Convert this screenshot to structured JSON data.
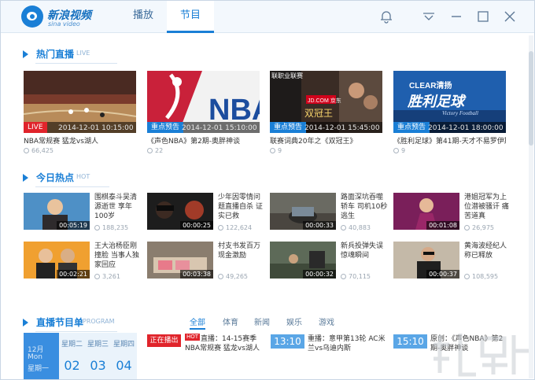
{
  "app": {
    "logo_cn": "新浪视频",
    "logo_en": "sina video",
    "tabs": [
      {
        "label": "播放"
      },
      {
        "label": "节目"
      }
    ],
    "active_tab": "节目",
    "accent": "#1a7fd6",
    "live_red": "#e0242b"
  },
  "hot_live": {
    "title": "热门直播",
    "title_en": "LIVE",
    "cards": [
      {
        "badge": "LIVE",
        "time": "2014-12-01 10:15:00",
        "title": "NBA常规赛 猛龙vs湖人",
        "meta": "66,425"
      },
      {
        "badge": "重点预告",
        "time": "2014-12-01 15:10:00",
        "title": "《声色NBA》第2期-奥胖神谈",
        "meta": "22"
      },
      {
        "badge": "重点预告",
        "time": "2014-12-01 15:45:00",
        "title": "联赛词典20年之《双冠王》",
        "meta": "9",
        "thumb_texts": [
          "联职业联赛",
          "JD.COM 京东",
          "双冠王"
        ]
      },
      {
        "badge": "重点预告",
        "time": "2014-12-01 18:00:00",
        "title": "《胜利足球》第41期-天才不易罗伊斯",
        "meta": "9",
        "thumb_texts": [
          "CLEAR清扬",
          "胜利足球",
          "Victory Football"
        ]
      }
    ]
  },
  "hot_today": {
    "title": "今日热点",
    "title_en": "HOT",
    "items": [
      {
        "duration": "00:05:19",
        "title": "围棋泰斗吴清源逝世 享年100岁",
        "count": "188,235"
      },
      {
        "duration": "00:00:25",
        "title": "少年因零情问题直播自杀 证实已救",
        "count": "122,624"
      },
      {
        "duration": "00:00:33",
        "title": "路面深坑吞噬轿车 司机10秒逃生",
        "count": "40,883"
      },
      {
        "duration": "00:01:08",
        "title": "港姐冠军为上位潜被骚讦 痛苦道真",
        "count": "26,975"
      },
      {
        "duration": "00:02:21",
        "title": "王大治杨臣刚撞脸 当事人独家回应",
        "count": "3,261"
      },
      {
        "duration": "00:03:38",
        "title": "村支书发百万现金激励",
        "count": "49,265"
      },
      {
        "duration": "00:00:32",
        "title": "新兵投弹失误惊魂瞬间",
        "count": "70,115"
      },
      {
        "duration": "00:00:37",
        "title": "黄海波经纪人称已释放",
        "count": "108,595"
      }
    ]
  },
  "program": {
    "title": "直播节目单",
    "title_en": "PROGRAM",
    "tabs": [
      {
        "label": "全部"
      },
      {
        "label": "体育"
      },
      {
        "label": "新闻"
      },
      {
        "label": "娱乐"
      },
      {
        "label": "游戏"
      }
    ],
    "calendar": {
      "month": "12月",
      "mon": "Mon",
      "today": "星期一",
      "days": [
        {
          "weekday": "星期二",
          "num": "02"
        },
        {
          "weekday": "星期三",
          "num": "03"
        },
        {
          "weekday": "星期四",
          "num": "04"
        }
      ]
    },
    "onair_label": "正在播出",
    "hot_tag": "HOT",
    "entries": [
      {
        "time": "",
        "text": "直播：14-15赛季NBA常规赛 猛龙vs湖人"
      },
      {
        "time": "13:10",
        "text": "重播：意甲第13轮 AC米兰vs乌迪内斯"
      },
      {
        "time": "15:10",
        "text": "原创：《声色NBA》第2期-奥胖神谈"
      }
    ]
  }
}
